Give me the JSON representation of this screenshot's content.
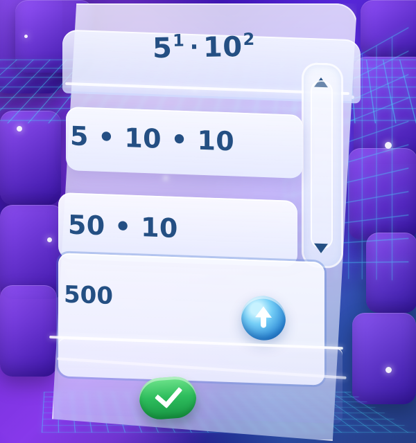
{
  "game": {
    "title": {
      "base1": "5",
      "exp1": "1",
      "operator": "·",
      "base2": "10",
      "exp2": "2"
    },
    "options": [
      "5 • 10 • 10",
      "50 • 10"
    ],
    "answer_value": "500",
    "buttons": {
      "up_icon": "up-arrow-icon",
      "confirm_icon": "checkmark-icon",
      "scroll_up_icon": "scroll-up-icon",
      "scroll_down_icon": "scroll-down-icon"
    },
    "colors": {
      "text": "#244f83",
      "confirm": "#2ebd5d",
      "up_button": "#2f8cd8",
      "background": "#4b1bc2"
    }
  }
}
